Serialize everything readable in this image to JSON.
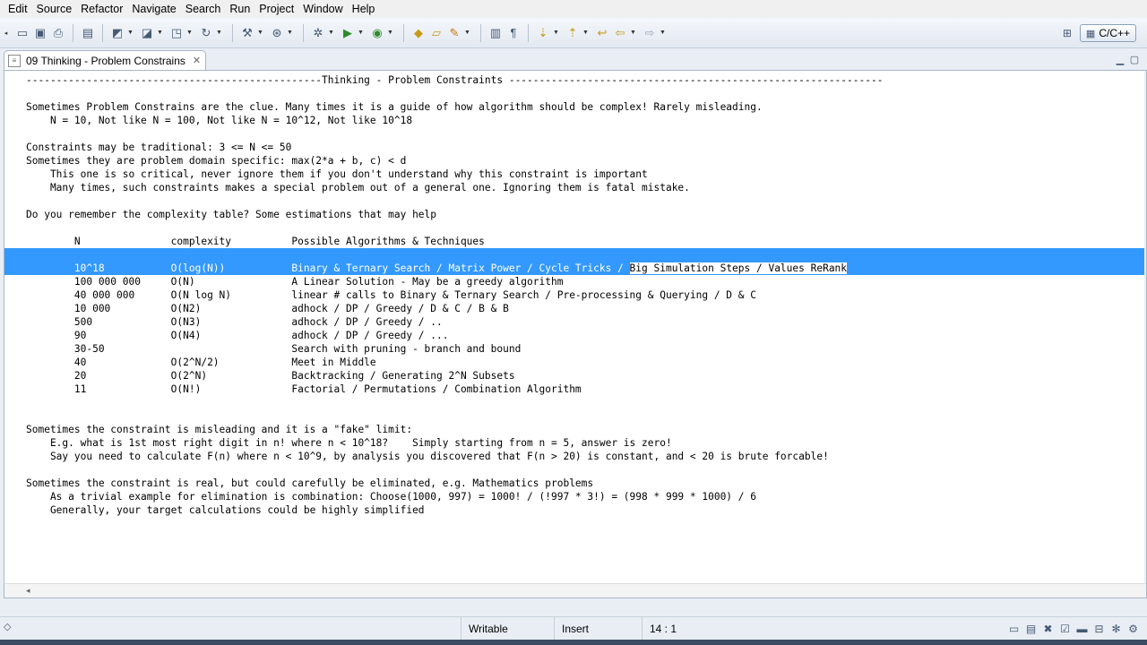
{
  "menu": [
    "Edit",
    "Source",
    "Refactor",
    "Navigate",
    "Search",
    "Run",
    "Project",
    "Window",
    "Help"
  ],
  "toolbar": {
    "perspective_label": "C/C++"
  },
  "editor_tab": {
    "title": "09 Thinking - Problem Constrains"
  },
  "editor": {
    "lines": [
      "-------------------------------------------------Thinking - Problem Constraints --------------------------------------------------------------",
      "",
      "Sometimes Problem Constrains are the clue. Many times it is a guide of how algorithm should be complex! Rarely misleading.",
      "    N = 10, Not like N = 100, Not like N = 10^12, Not like 10^18",
      "",
      "Constraints may be traditional: 3 <= N <= 50",
      "Sometimes they are problem domain specific: max(2*a + b, c) < d",
      "    This one is so critical, never ignore them if you don't understand why this constraint is important",
      "    Many times, such constraints makes a special problem out of a general one. Ignoring them is fatal mistake.",
      "",
      "Do you remember the complexity table? Some estimations that may help",
      "",
      "        N               complexity          Possible Algorithms & Techniques",
      "",
      "        10^18           O(log(N))           Binary & Ternary Search / Matrix Power / Cycle Tricks / ",
      "        100 000 000     O(N)                A Linear Solution - May be a greedy algorithm",
      "        40 000 000      O(N log N)          linear # calls to Binary & Ternary Search / Pre-processing & Querying / D & C",
      "        10 000          O(N2)               adhock / DP / Greedy / D & C / B & B",
      "        500             O(N3)               adhock / DP / Greedy / ..",
      "        90              O(N4)               adhock / DP / Greedy / ...",
      "        30-50                               Search with pruning - branch and bound",
      "        40              O(2^N/2)            Meet in Middle",
      "        20              O(2^N)              Backtracking / Generating 2^N Subsets",
      "        11              O(N!)               Factorial / Permutations / Combination Algorithm",
      "",
      "",
      "Sometimes the constraint is misleading and it is a \"fake\" limit:",
      "    E.g. what is 1st most right digit in n! where n < 10^18?    Simply starting from n = 5, answer is zero!",
      "    Say you need to calculate F(n) where n < 10^9, by analysis you discovered that F(n > 20) is constant, and < 20 is brute forcable!",
      "",
      "Sometimes the constraint is real, but could carefully be eliminated, e.g. Mathematics problems",
      "    As a trivial example for elimination is combination: Choose(1000, 997) = 1000! / (!997 * 3!) = (998 * 999 * 1000) / 6",
      "    Generally, your target calculations could be highly simplified"
    ],
    "selected_line_tail": "Big Simulation Steps / Values ReRank"
  },
  "status": {
    "writable": "Writable",
    "insert": "Insert",
    "position": "14 : 1"
  }
}
